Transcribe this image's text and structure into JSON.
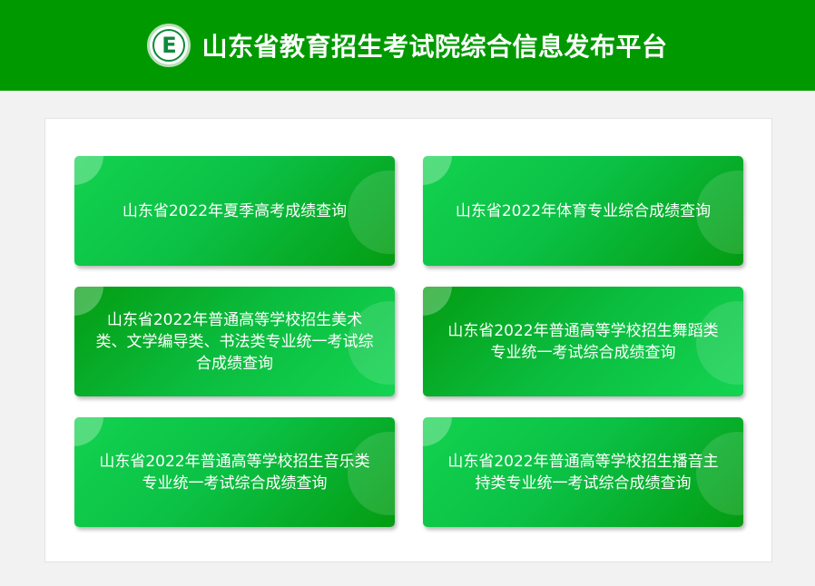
{
  "header": {
    "title": "山东省教育招生考试院综合信息发布平台",
    "logo_letter": "E",
    "logo_icon": "exam-institute-seal-icon",
    "background_color": "#009a00"
  },
  "cards": [
    {
      "label": "山东省2022年夏季高考成绩查询"
    },
    {
      "label": "山东省2022年体育专业综合成绩查询"
    },
    {
      "label": "山东省2022年普通高等学校招生美术类、文学编导类、书法类专业统一考试综合成绩查询"
    },
    {
      "label": "山东省2022年普通高等学校招生舞蹈类专业统一考试综合成绩查询"
    },
    {
      "label": "山东省2022年普通高等学校招生音乐类专业统一考试综合成绩查询"
    },
    {
      "label": "山东省2022年普通高等学校招生播音主持类专业统一考试综合成绩查询"
    }
  ],
  "colors": {
    "card_light": "#13d24f",
    "card_dark": "#049c12",
    "page_background": "#f2f2f2",
    "panel_background": "#ffffff"
  }
}
